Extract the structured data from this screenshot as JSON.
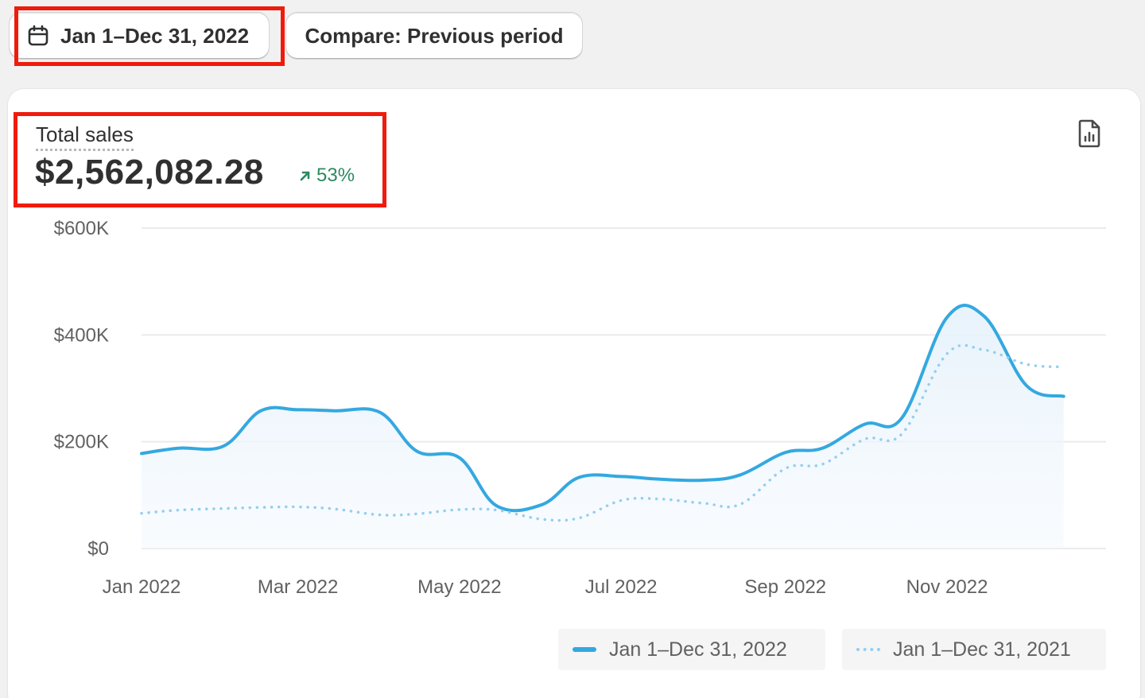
{
  "toolbar": {
    "date_range_label": "Jan 1–Dec 31, 2022",
    "compare_label": "Compare: Previous period"
  },
  "metric": {
    "label": "Total sales",
    "value": "$2,562,082.28",
    "change": "53%",
    "change_direction": "up",
    "change_color": "#2b8a5e"
  },
  "icons": {
    "calendar": "calendar-icon",
    "report": "report-icon",
    "trend": "arrow-up-right-icon"
  },
  "colors": {
    "primary_series": "#34a8e0",
    "comparison_series": "#93cff0",
    "highlight": "#ef1b0c"
  },
  "chart_data": {
    "type": "line",
    "x": [
      "2022-01-01",
      "2022-01-15",
      "2022-02-01",
      "2022-02-15",
      "2022-03-01",
      "2022-03-15",
      "2022-04-01",
      "2022-04-15",
      "2022-05-01",
      "2022-05-15",
      "2022-06-01",
      "2022-06-15",
      "2022-07-01",
      "2022-07-15",
      "2022-08-01",
      "2022-08-15",
      "2022-09-01",
      "2022-09-15",
      "2022-10-01",
      "2022-10-15",
      "2022-11-01",
      "2022-11-15",
      "2022-12-01",
      "2022-12-15"
    ],
    "x_tick_labels": [
      "Jan 2022",
      "Mar 2022",
      "May 2022",
      "Jul 2022",
      "Sep 2022",
      "Nov 2022"
    ],
    "y_tick_labels": [
      "$600K",
      "$400K",
      "$200K",
      "$0"
    ],
    "ylim": [
      0,
      600000
    ],
    "grid": true,
    "legend_position": "bottom-right",
    "series": [
      {
        "name": "Jan 1–Dec 31, 2022",
        "style": "solid",
        "values": [
          178000,
          188000,
          192000,
          258000,
          260000,
          258000,
          255000,
          182000,
          170000,
          80000,
          82000,
          133000,
          135000,
          130000,
          128000,
          138000,
          180000,
          188000,
          233000,
          245000,
          433000,
          435000,
          305000,
          285000
        ]
      },
      {
        "name": "Jan 1–Dec 31, 2021",
        "style": "dotted",
        "values": [
          66000,
          72000,
          75000,
          77000,
          78000,
          74000,
          63000,
          65000,
          73000,
          72000,
          55000,
          57000,
          90000,
          93000,
          85000,
          83000,
          150000,
          158000,
          205000,
          215000,
          365000,
          372000,
          345000,
          340000
        ]
      }
    ]
  }
}
